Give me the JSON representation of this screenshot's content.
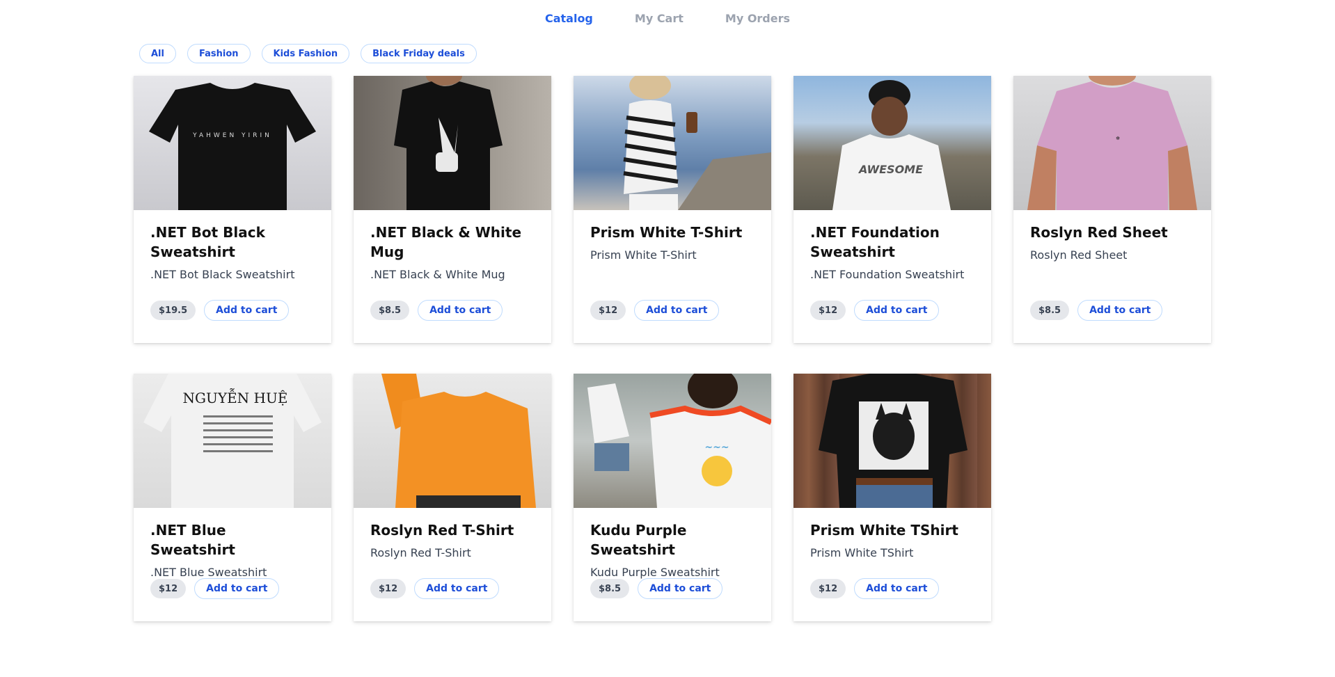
{
  "nav": {
    "items": [
      {
        "label": "Catalog",
        "active": true
      },
      {
        "label": "My Cart",
        "active": false
      },
      {
        "label": "My Orders",
        "active": false
      }
    ],
    "active_color": "#2563eb"
  },
  "filters": [
    "All",
    "Fashion",
    "Kids Fashion",
    "Black Friday deals"
  ],
  "add_label": "Add to cart",
  "products": [
    {
      "title": ".NET Bot Black Sweatshirt",
      "desc": ".NET Bot Black Sweatshirt",
      "price": "$19.5",
      "image": "black-tshirt-image",
      "print_text": "YAHWEN YIRIN"
    },
    {
      "title": ".NET Black & White Mug",
      "desc": ".NET Black & White Mug",
      "price": "$8.5",
      "image": "skeleton-hand-tshirt-image"
    },
    {
      "title": "Prism White T-Shirt",
      "desc": "Prism White T-Shirt",
      "price": "$12",
      "image": "striped-sweater-image"
    },
    {
      "title": ".NET Foundation Sweatshirt",
      "desc": ".NET Foundation Sweatshirt",
      "price": "$12",
      "image": "awesome-tshirt-image"
    },
    {
      "title": "Roslyn Red Sheet",
      "desc": "Roslyn Red Sheet",
      "price": "$8.5",
      "image": "pink-tshirt-image"
    },
    {
      "title": ".NET Blue Sweatshirt",
      "desc": ".NET Blue Sweatshirt",
      "price": "$12",
      "image": "nguyen-hue-tshirt-image",
      "print_text": "NGUYỄN HUỆ"
    },
    {
      "title": "Roslyn Red T-Shirt",
      "desc": "Roslyn Red T-Shirt",
      "price": "$12",
      "image": "orange-tshirt-image"
    },
    {
      "title": "Kudu Purple Sweatshirt",
      "desc": "Kudu Purple Sweatshirt",
      "price": "$8.5",
      "image": "sunny-tshirt-image"
    },
    {
      "title": "Prism White TShirt",
      "desc": "Prism White TShirt",
      "price": "$12",
      "image": "dog-tshirt-image"
    }
  ]
}
